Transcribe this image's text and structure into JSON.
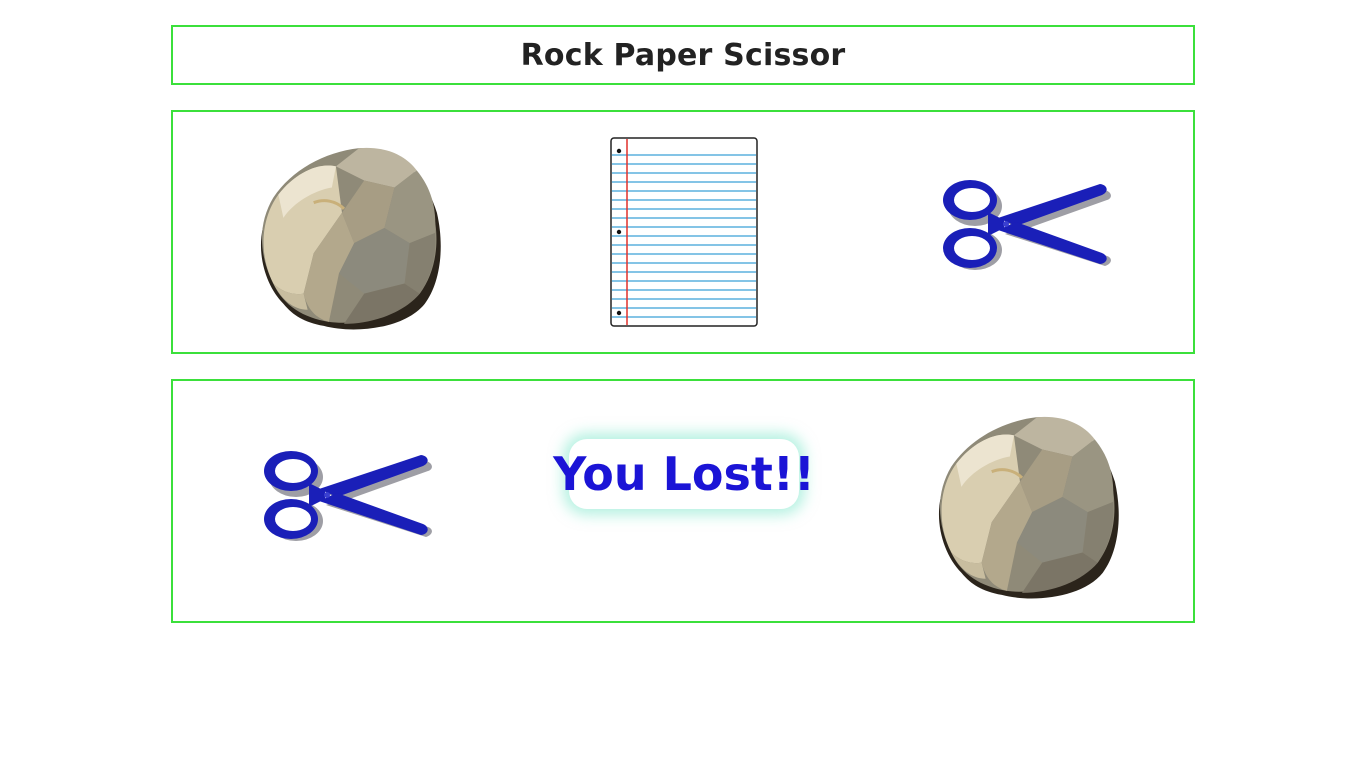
{
  "header": {
    "title": "Rock Paper Scissor"
  },
  "choices": [
    {
      "name": "rock",
      "icon": "rock-icon"
    },
    {
      "name": "paper",
      "icon": "paper-icon"
    },
    {
      "name": "scissor",
      "icon": "scissors-icon"
    }
  ],
  "result": {
    "player_choice_icon": "scissors-icon",
    "computer_choice_icon": "rock-icon",
    "message": "You Lost!!",
    "message_color": "#1b14d6"
  },
  "colors": {
    "border": "#3be03b",
    "scissors": "#1a1fb8",
    "paper_lines": "#3aa0d8",
    "paper_margin": "#e0312b"
  }
}
